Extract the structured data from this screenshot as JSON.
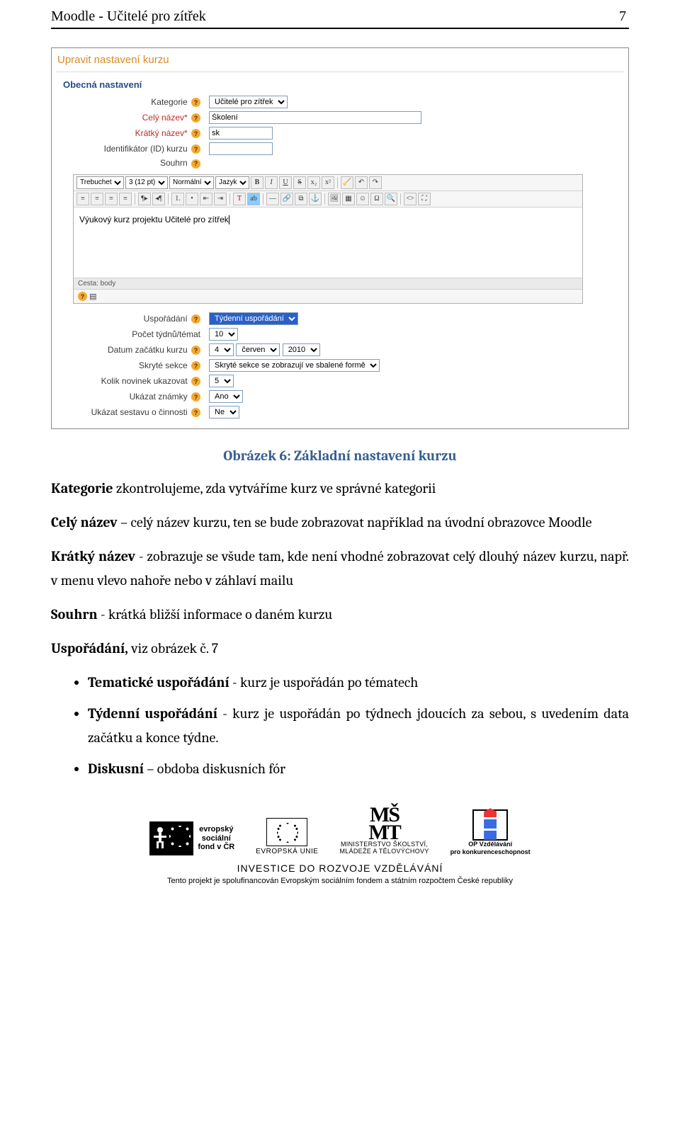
{
  "header": {
    "title": "Moodle - Učitelé pro zítřek",
    "page_number": "7"
  },
  "form": {
    "title": "Upravit nastavení kurzu",
    "section_general": "Obecná nastavení",
    "labels": {
      "kategorie": "Kategorie",
      "cely_nazev": "Celý název*",
      "kratky_nazev": "Krátký název*",
      "id": "Identifikátor (ID) kurzu",
      "souhrn": "Souhrn",
      "usporadani": "Uspořádání",
      "pocet": "Počet týdnů/témat",
      "datum": "Datum začátku kurzu",
      "skryte": "Skryté sekce",
      "novinky": "Kolik novinek ukazovat",
      "znamky": "Ukázat známky",
      "cinnost": "Ukázat sestavu o činnosti"
    },
    "values": {
      "kategorie": "Učitelé pro zítřek",
      "cely_nazev": "Školení",
      "kratky_nazev": "sk",
      "id": "",
      "usporadani": "Týdenní uspořádání",
      "pocet": "10",
      "datum_d": "4",
      "datum_m": "červen",
      "datum_y": "2010",
      "skryte": "Skryté sekce se zobrazují ve sbalené formě",
      "novinky": "5",
      "znamky": "Ano",
      "cinnost": "Ne"
    },
    "editor": {
      "font": "Trebuchet",
      "size": "3 (12 pt)",
      "style": "Normální",
      "lang": "Jazyk",
      "content": "Výukový kurz projektu Učitelé pro zítřek",
      "path": "Cesta: body"
    }
  },
  "doc": {
    "caption": "Obrázek 6: Základní nastavení kurzu",
    "p1a": "Kategorie",
    "p1b": " zkontrolujeme, zda vytváříme kurz ve správné kategorii",
    "p2a": "Celý název",
    "p2b": " – celý název kurzu, ten se bude zobrazovat například na úvodní obrazovce Moodle",
    "p3a": "Krátký název",
    "p3b": " - zobrazuje se všude tam, kde není vhodné zobrazovat celý dlouhý název kurzu, např. v menu vlevo nahoře nebo v záhlaví mailu",
    "p4a": "Souhrn",
    "p4b": " - krátká bližší informace o daném kurzu",
    "p5a": "Uspořádání,",
    "p5b": " viz obrázek č. 7",
    "li1a": "Tematické uspořádání",
    "li1b": " - kurz je uspořádán po tématech",
    "li2a": "Týdenní uspořádání",
    "li2b": " - kurz je uspořádán po týdnech jdoucích za sebou, s uvedením data začátku a konce týdne.",
    "li3a": "Diskusní",
    "li3b": " – obdoba diskusních fór"
  },
  "footer": {
    "esf1": "evropský",
    "esf2": "sociální",
    "esf3": "fond v ČR",
    "eu": "EVROPSKÁ UNIE",
    "msmt1": "MINISTERSTVO ŠKOLSTVÍ,",
    "msmt2": "MLÁDEŽE A TĚLOVÝCHOVY",
    "op1": "OP Vzdělávání",
    "op2": "pro konkurenceschopnost",
    "invest": "INVESTICE DO ROZVOJE VZDĚLÁVÁNÍ",
    "cofin": "Tento projekt je spolufinancován Evropským sociálním fondem a státním rozpočtem České republiky"
  }
}
